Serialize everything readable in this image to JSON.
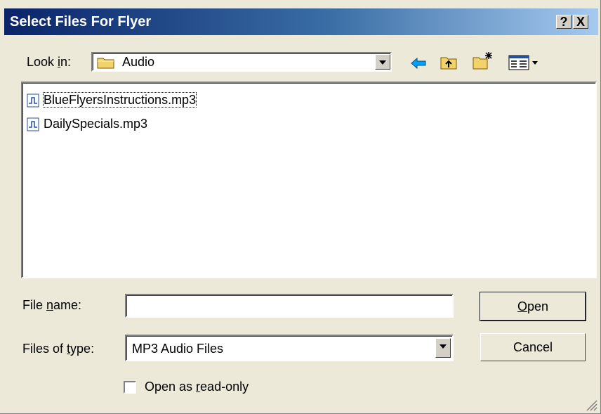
{
  "title": "Select Files For Flyer",
  "title_buttons": {
    "help": "?",
    "close": "X"
  },
  "lookin": {
    "label_pre": "Look ",
    "label_key": "i",
    "label_post": "n:",
    "value": "Audio"
  },
  "files": [
    {
      "name": "BlueFlyersInstructions.mp3"
    },
    {
      "name": "DailySpecials.mp3"
    }
  ],
  "filename": {
    "label_pre": "File ",
    "label_key": "n",
    "label_post": "ame:",
    "value": ""
  },
  "filetype": {
    "label_pre": "Files of ",
    "label_key": "t",
    "label_post": "ype:",
    "value": "MP3 Audio Files"
  },
  "readonly": {
    "label_pre": "Open as ",
    "label_key": "r",
    "label_post": "ead-only",
    "checked": false
  },
  "buttons": {
    "open_key": "O",
    "open_rest": "pen",
    "cancel": "Cancel"
  },
  "colors": {
    "title_start": "#0a246a",
    "title_end": "#a6caf0",
    "face": "#ece9d8"
  }
}
